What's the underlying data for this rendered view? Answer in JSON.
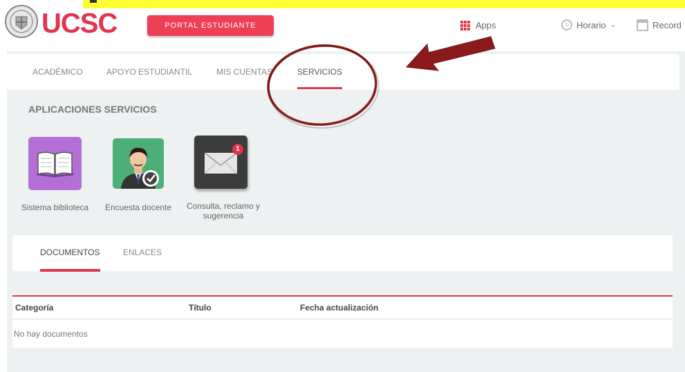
{
  "header": {
    "brand": "UCSC",
    "portal_button": "PORTAL ESTUDIANTE",
    "apps_label": "Apps",
    "horario_label": "Horario",
    "record_label": "Record"
  },
  "nav": {
    "tabs": [
      {
        "label": "ACADÉMICO"
      },
      {
        "label": "APOYO ESTUDIANTIL"
      },
      {
        "label": "MIS CUENTAS"
      },
      {
        "label": "SERVICIOS",
        "active": true
      }
    ]
  },
  "services": {
    "title": "APLICACIONES SERVICIOS",
    "apps": [
      {
        "label": "Sistema biblioteca",
        "icon": "book-icon",
        "color": "#b36fd6"
      },
      {
        "label": "Encuesta docente",
        "icon": "teacher-check-icon",
        "color": "#4caf77"
      },
      {
        "label_line1": "Consulta, reclamo y",
        "label_line2": "sugerencia",
        "icon": "mail-icon",
        "color": "#3c3c3c",
        "badge": "1"
      }
    ]
  },
  "documents": {
    "tabs": [
      {
        "label": "DOCUMENTOS",
        "active": true
      },
      {
        "label": "ENLACES"
      }
    ],
    "columns": [
      "Categoría",
      "Título",
      "Fecha actualización"
    ],
    "empty_message": "No hay documentos"
  },
  "colors": {
    "accent": "#e0354c",
    "background": "#edf1f1",
    "annotation": "#8b1a1a"
  }
}
